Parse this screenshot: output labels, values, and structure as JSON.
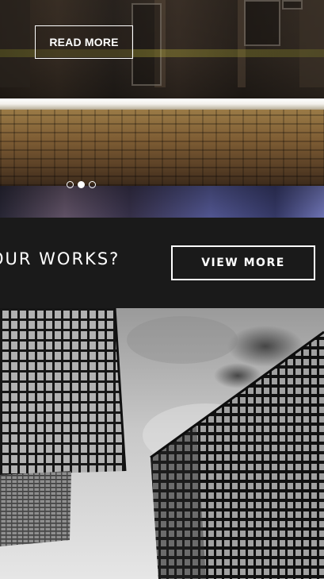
{
  "hero": {
    "read_more_label": "READ MORE",
    "slides": [
      {
        "active": false
      },
      {
        "active": true
      },
      {
        "active": false
      }
    ]
  },
  "cta": {
    "text": "OUR WORKS?",
    "button_label": "VIEW MORE"
  },
  "colors": {
    "band_background": "#1a1a1a",
    "button_border": "#ffffff",
    "text": "#ffffff"
  }
}
